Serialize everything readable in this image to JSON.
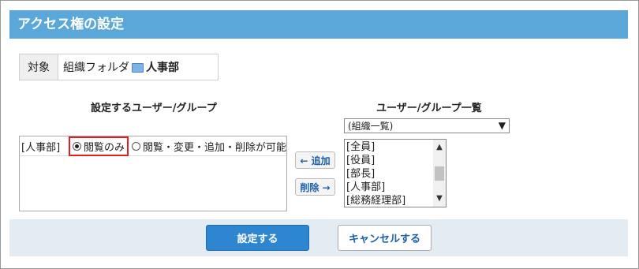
{
  "title": "アクセス権の設定",
  "target": {
    "label": "対象",
    "path": "組織フォルダ",
    "name": "人事部"
  },
  "left_panel": {
    "heading": "設定するユーザー/グループ",
    "entries": [
      {
        "name": "[人事部]",
        "options": [
          "閲覧のみ",
          "閲覧・変更・追加・削除が可能"
        ],
        "selected": "閲覧のみ"
      }
    ]
  },
  "buttons": {
    "add": "← 追加",
    "remove": "削除 →",
    "confirm": "設定する",
    "cancel": "キャンセルする"
  },
  "right_panel": {
    "heading": "ユーザー/グループ一覧",
    "select_value": "(組織一覧)",
    "items": [
      "[全員]",
      "[役員]",
      "[部長]",
      "[人事部]",
      "[総務経理部]"
    ]
  },
  "colors": {
    "header_bg": "#5aa7d9",
    "primary_button": "#2e86d1",
    "highlight_border": "#e02020",
    "footer_bg": "#e3ecf3"
  }
}
